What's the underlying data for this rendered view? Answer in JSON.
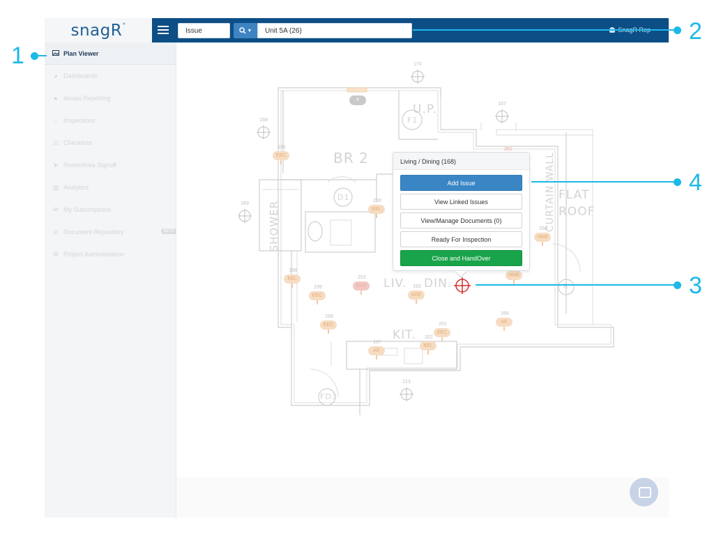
{
  "header": {
    "logo": "snagR",
    "search_type": "Issue",
    "location": "Unit 5A (26)",
    "user": "SnagR Rep"
  },
  "sidebar": {
    "items": [
      {
        "label": "Plan Viewer",
        "icon": "image-icon",
        "active": true
      },
      {
        "label": "Dashboards",
        "icon": "dashboard-icon"
      },
      {
        "label": "Issues Reporting",
        "icon": "map-marker-icon"
      },
      {
        "label": "Inspections",
        "icon": "search-icon"
      },
      {
        "label": "Checklists",
        "icon": "checkbox-icon"
      },
      {
        "label": "Room/Area Signoff",
        "icon": "location-arrow-icon"
      },
      {
        "label": "Analytics",
        "icon": "bar-chart-icon"
      },
      {
        "label": "My Subscriptions",
        "icon": "envelope-icon"
      },
      {
        "label": "Document Repository",
        "icon": "paperclip-icon",
        "badge": "BETA"
      },
      {
        "label": "Project Administration",
        "icon": "cogs-icon"
      }
    ]
  },
  "plan": {
    "rooms": {
      "up": "U.P.",
      "br2": "BR 2",
      "d1": "D1",
      "f1": "F1",
      "shower": "SHOWER",
      "liv": "LIV.",
      "din": "DIN.",
      "kit": "KIT.",
      "flat": "FLAT",
      "roof": "ROOF",
      "curtain_wall": "CURTAIN WALL",
      "fd3": "FD3",
      "r": "R"
    },
    "pins": [
      {
        "num": "191",
        "tag": "EEC"
      },
      {
        "num": "200",
        "tag": "KEL"
      },
      {
        "num": "198",
        "tag": "KEL"
      },
      {
        "num": "199",
        "tag": "EEC"
      },
      {
        "num": "252",
        "tag": "ELO"
      },
      {
        "num": "193",
        "tag": "ARE"
      },
      {
        "num": "258",
        "tag": "EEC"
      },
      {
        "num": "197",
        "tag": "AE"
      },
      {
        "num": "202",
        "tag": "KEL"
      },
      {
        "num": "201",
        "tag": "EEC"
      },
      {
        "num": "260",
        "tag": "AE"
      },
      {
        "num": "258",
        "tag": "HMB"
      },
      {
        "num": "261",
        "tag": ""
      },
      {
        "num": "",
        "tag": "HMB"
      }
    ],
    "targets": [
      {
        "num": "170"
      },
      {
        "num": "168"
      },
      {
        "num": "167"
      },
      {
        "num": "169"
      },
      {
        "num": "213"
      }
    ],
    "cluster": "4"
  },
  "popup": {
    "title": "Living / Dining (168)",
    "buttons": {
      "add_issue": "Add Issue",
      "view_linked": "View Linked Issues",
      "view_manage_docs": "View/Manage Documents (0)",
      "ready_inspection": "Ready For Inspection",
      "close_handover": "Close and HandOver"
    }
  },
  "callouts": {
    "c1": "1",
    "c2": "2",
    "c3": "3",
    "c4": "4"
  }
}
